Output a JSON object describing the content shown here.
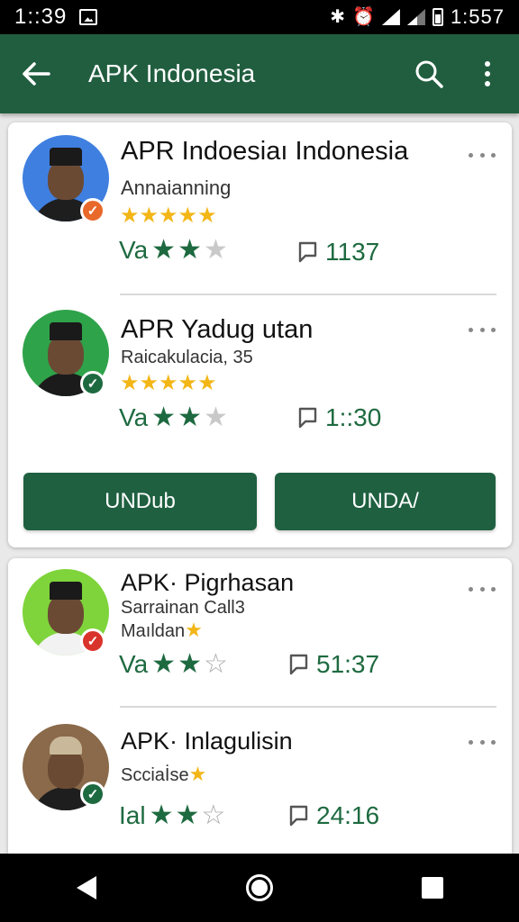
{
  "status_bar": {
    "time": "1::39",
    "clock": "1:557",
    "icons": [
      "image-icon",
      "bluetooth-icon",
      "alarm-icon",
      "wifi-icon",
      "signal-icon",
      "battery-icon"
    ]
  },
  "app_bar": {
    "title": "APK Indonesia",
    "background": "#215e3f",
    "icons": [
      "back-arrow-icon",
      "search-icon",
      "more-vert-icon"
    ]
  },
  "colors": {
    "accent": "#1e6a40",
    "star_gold": "#f3b617",
    "button": "#1e6040"
  },
  "cards": [
    {
      "items": [
        {
          "title": "APR Indoesiaı Indonesia",
          "subtitle": "Annaianning",
          "gold_stars": "★★★★★",
          "rating_label": "Va",
          "rating": 2,
          "rating_max": 3,
          "comments": "1137",
          "badge": "orange"
        },
        {
          "title": "APR Yadug utan",
          "subtitle": "Raicakulacia, 35",
          "gold_stars": "★★★★★",
          "rating_label": "Va",
          "rating": 2,
          "rating_max": 3,
          "comments": "1::30",
          "badge": "green"
        }
      ],
      "buttons": [
        "UNDub",
        "UNDA/"
      ]
    },
    {
      "items": [
        {
          "title": "APK· Pigrhasan",
          "subtitle": "Sarrainan Call3",
          "subtitle2": "Maıldan",
          "gold_stars": "★",
          "rating_label": "Va",
          "rating": 2,
          "rating_max": 3,
          "comments": "51:37",
          "badge": "red"
        },
        {
          "title": "APK· Inlagulisin",
          "subtitle": "Scciaİse",
          "gold_stars": "★",
          "rating_label": "Ial",
          "rating": 2,
          "rating_max": 3,
          "comments": "24:16",
          "badge": "green"
        }
      ]
    }
  ],
  "nav_bar": {
    "icons": [
      "nav-back-icon",
      "nav-home-icon",
      "nav-recents-icon"
    ]
  }
}
